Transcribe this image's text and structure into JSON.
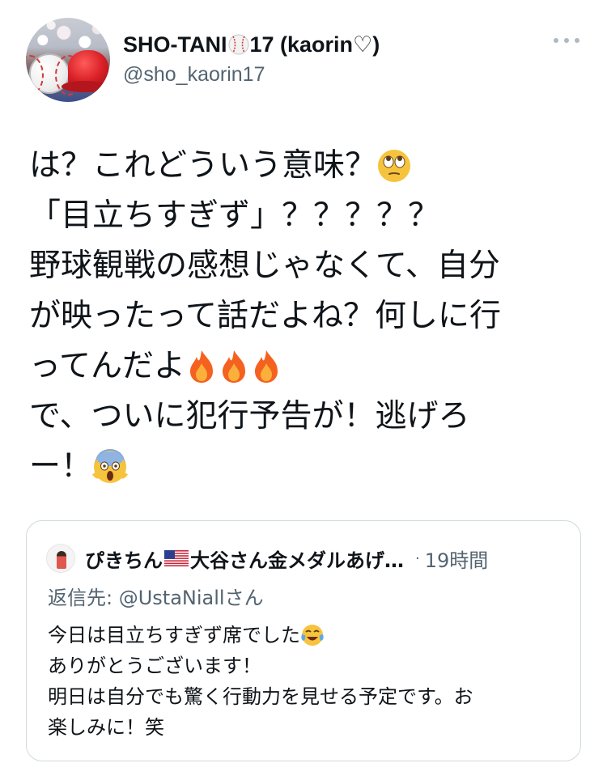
{
  "author": {
    "display_name_prefix": "SHO-TANI",
    "display_name_suffix": "17 (kaorin♡)",
    "handle": "@sho_kaorin17",
    "avatar_icon": "baseball-and-red-helmet-avatar"
  },
  "tweet": {
    "lines": [
      "は？これどういう意味？",
      "「目立ちすぎず」？？？？？",
      "野球観戦の感想じゃなくて、自分",
      "が映ったって話だよね？何しに行",
      "ってんだよ",
      "で、ついに犯行予告が！逃げろ",
      "ー！"
    ],
    "emojis": {
      "line1": "face-with-rolling-eyes",
      "line5": "fire x3",
      "line7": "face-screaming-in-fear"
    }
  },
  "quote": {
    "name_prefix": "ぴきちん",
    "name_suffix": "大谷さん金メダルあげ…",
    "separator": "·",
    "time": "19時間",
    "reply_to": "返信先: @UstaNiallさん",
    "lines": [
      "今日は目立ちすぎず席でした",
      "ありがとうございます！",
      "明日は自分でも驚く行動力を見せる予定です。お",
      "楽しみに！笑"
    ],
    "flag_icon": "us-flag"
  },
  "colors": {
    "text": "#0f1419",
    "secondary": "#536471",
    "border": "#cfd9de"
  }
}
